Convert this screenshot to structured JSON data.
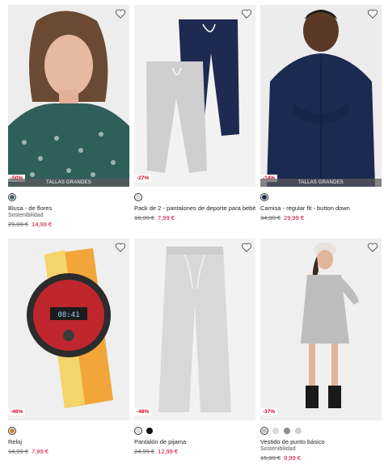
{
  "products": [
    {
      "title": "Blusa - de flores",
      "subtitle": "Sostenibilidad",
      "old_price": "29,99 €",
      "new_price": "14,99 €",
      "discount": "-50%",
      "banner": "TALLAS GRANDES",
      "swatches": [
        "#4a6468"
      ],
      "selected": 0
    },
    {
      "title": "Pack de 2 - pantalones de deporte para bebé",
      "subtitle": "",
      "old_price": "10,99 €",
      "new_price": "7,99 €",
      "discount": "-27%",
      "banner": "",
      "swatches": [
        "#d7d7d7"
      ],
      "selected": 0
    },
    {
      "title": "Camisa - regular fit - button down",
      "subtitle": "",
      "old_price": "34,99 €",
      "new_price": "29,99 €",
      "discount": "-14%",
      "banner": "TALLAS GRANDES",
      "swatches": [
        "#1d2a4d"
      ],
      "selected": 0
    },
    {
      "title": "Reloj",
      "subtitle": "",
      "old_price": "14,99 €",
      "new_price": "7,99 €",
      "discount": "-46%",
      "banner": "",
      "swatches": [
        "#c8853a"
      ],
      "selected": 0
    },
    {
      "title": "Pantalón de pijama",
      "subtitle": "",
      "old_price": "24,99 €",
      "new_price": "12,99 €",
      "discount": "-48%",
      "banner": "",
      "swatches": [
        "#dedede",
        "#111111"
      ],
      "selected": 0
    },
    {
      "title": "Vestido de punto básico",
      "subtitle": "Sostenibilidad",
      "old_price": "15,99 €",
      "new_price": "9,99 €",
      "discount": "-37%",
      "banner": "",
      "swatches": [
        "#bdbdbd",
        "#dadada",
        "#8e8e8e",
        "#cfcfcf"
      ],
      "selected": 0
    }
  ],
  "colors": {
    "discount": "#d4002a",
    "banner_bg": "#5a5a5a"
  },
  "icons": {
    "wishlist": "heart-outline-icon"
  }
}
